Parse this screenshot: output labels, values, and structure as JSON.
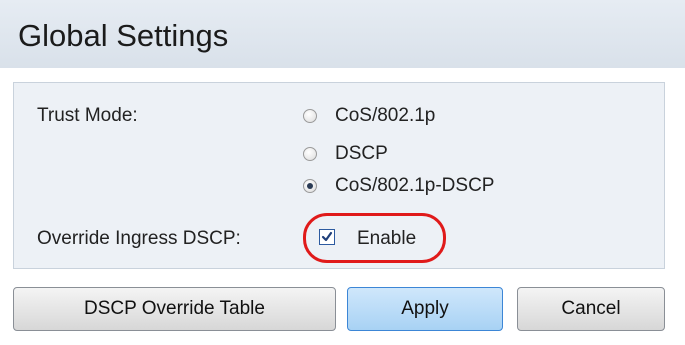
{
  "title": "Global Settings",
  "trust_mode": {
    "label": "Trust Mode:",
    "options": [
      "CoS/802.1p",
      "DSCP",
      "CoS/802.1p-DSCP"
    ],
    "selected": "CoS/802.1p-DSCP"
  },
  "override_ingress": {
    "label": "Override Ingress DSCP:",
    "checkbox_label": "Enable",
    "checked": true,
    "highlight_color": "#e01a1a"
  },
  "buttons": {
    "dscp_override": "DSCP Override Table",
    "apply": "Apply",
    "cancel": "Cancel"
  }
}
